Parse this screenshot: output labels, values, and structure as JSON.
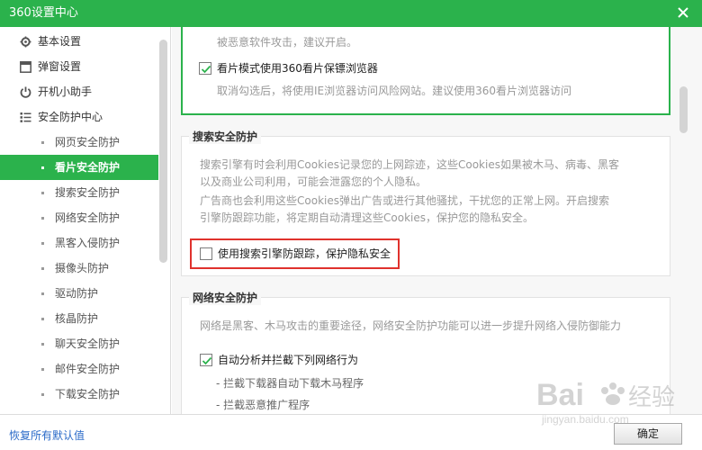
{
  "window": {
    "title": "360设置中心"
  },
  "sidebar": {
    "items": [
      {
        "label": "基本设置",
        "icon": "gear-icon"
      },
      {
        "label": "弹窗设置",
        "icon": "window-icon"
      },
      {
        "label": "开机小助手",
        "icon": "power-icon"
      },
      {
        "label": "安全防护中心",
        "icon": "list-icon"
      }
    ],
    "sub_items": [
      "网页安全防护",
      "看片安全防护",
      "搜索安全防护",
      "网络安全防护",
      "黑客入侵防护",
      "摄像头防护",
      "驱动防护",
      "核晶防护",
      "聊天安全防护",
      "邮件安全防护",
      "下载安全防护"
    ],
    "active_sub": "看片安全防护"
  },
  "content": {
    "video_section": {
      "top_desc": "被恶意软件攻击，建议开启。",
      "checkbox_label": "看片模式使用360看片保镖浏览器",
      "checkbox_checked": true,
      "checkbox_desc": "取消勾选后，将使用IE浏览器访问风险网站。建议使用360看片浏览器访问"
    },
    "search_section": {
      "title": "搜索安全防护",
      "desc_lines": [
        "搜索引擎有时会利用Cookies记录您的上网踪迹，这些Cookies如果被木马、病毒、黑客",
        "以及商业公司利用，可能会泄露您的个人隐私。",
        "广告商也会利用这些Cookies弹出广告或进行其他骚扰，干扰您的正常上网。开启搜索",
        "引擎防跟踪功能，将定期自动清理这些Cookies，保护您的隐私安全。"
      ],
      "checkbox_label": "使用搜索引擎防跟踪，保护隐私安全",
      "checkbox_checked": false
    },
    "network_section": {
      "title": "网络安全防护",
      "desc": "网络是黑客、木马攻击的重要途径，网络安全防护功能可以进一步提升网络入侵防御能力",
      "checkbox_label": "自动分析并拦截下列网络行为",
      "checkbox_checked": true,
      "sub_lines": [
        "- 拦截下载器自动下载木马程序",
        "- 拦截恶意推广程序"
      ]
    }
  },
  "footer": {
    "restore_label": "恢复所有默认值",
    "ok_label": "确定"
  },
  "watermark": {
    "brand": "Bai",
    "brand2": "经验",
    "url": "jingyan.baidu.com"
  },
  "colors": {
    "brand": "#2bb24c",
    "highlight": "#e0322d",
    "link": "#2a6ac8"
  }
}
